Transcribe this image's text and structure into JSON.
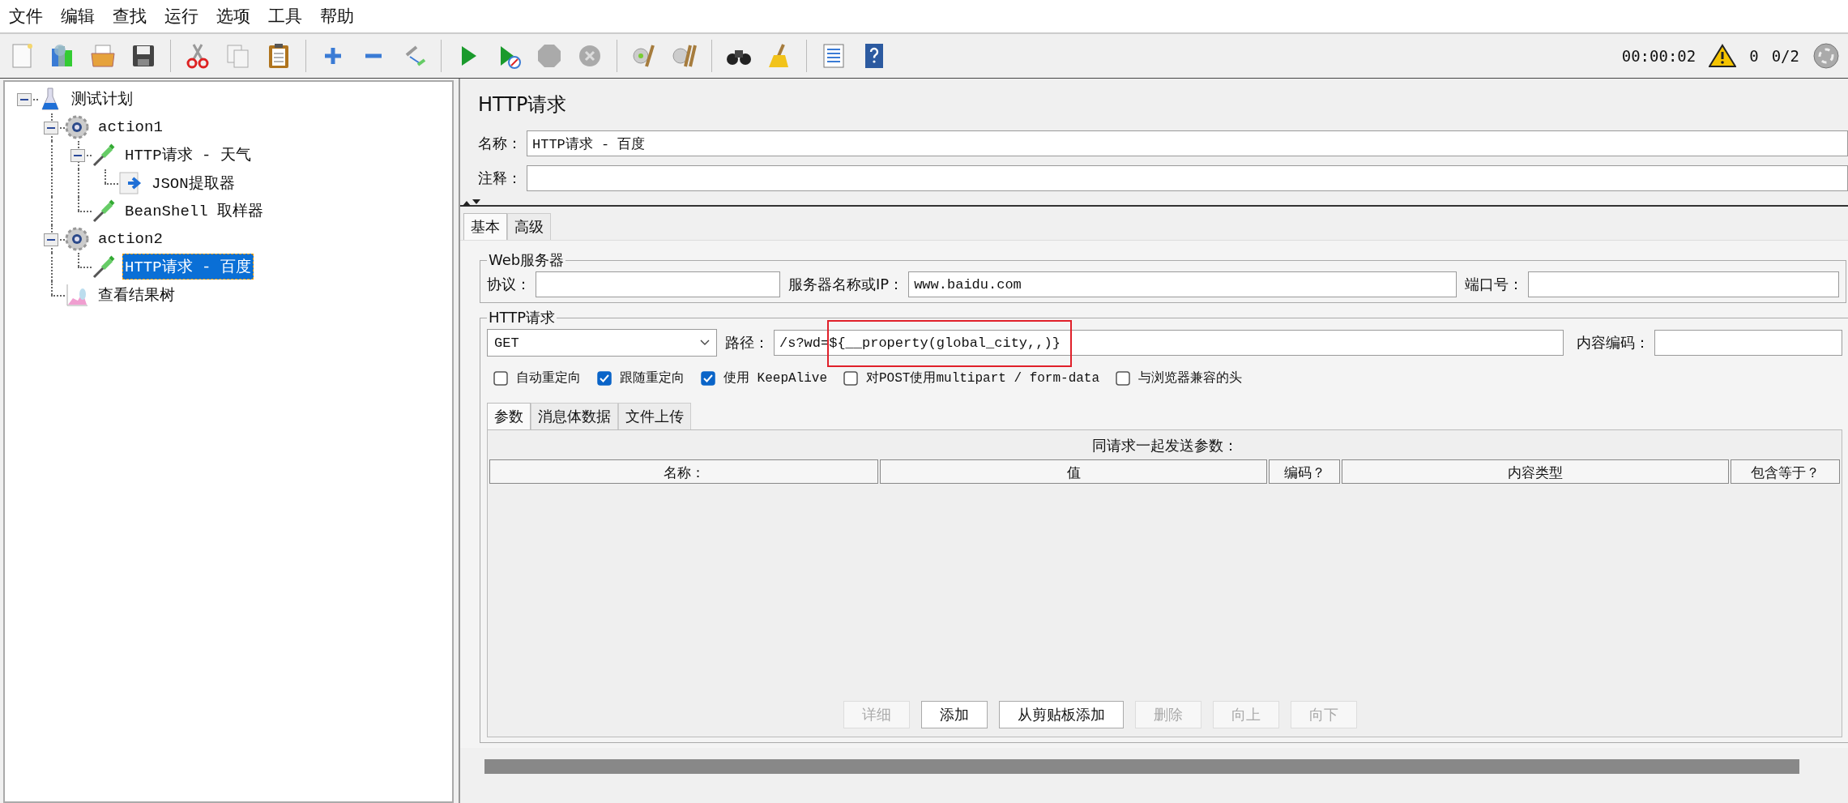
{
  "menu": [
    "文件",
    "编辑",
    "查找",
    "运行",
    "选项",
    "工具",
    "帮助"
  ],
  "status": {
    "elapsed": "00:00:02",
    "warnings": "0",
    "threads": "0/2"
  },
  "tree": [
    {
      "label": "测试计划",
      "kind": "plan",
      "expanded": true,
      "selected": false,
      "children": [
        {
          "label": "action1",
          "kind": "thread-group",
          "expanded": true,
          "selected": false,
          "children": [
            {
              "label": "HTTP请求 - 天气",
              "kind": "sampler",
              "expanded": true,
              "selected": false,
              "children": [
                {
                  "label": "JSON提取器",
                  "kind": "extractor",
                  "selected": false
                }
              ]
            },
            {
              "label": "BeanShell 取样器",
              "kind": "sampler",
              "selected": false
            }
          ]
        },
        {
          "label": "action2",
          "kind": "thread-group",
          "expanded": true,
          "selected": false,
          "children": [
            {
              "label": "HTTP请求 - 百度",
              "kind": "sampler",
              "selected": true
            }
          ]
        },
        {
          "label": "查看结果树",
          "kind": "listener",
          "selected": false
        }
      ]
    }
  ],
  "panel": {
    "title": "HTTP请求",
    "name": {
      "label": "名称：",
      "value": "HTTP请求 - 百度"
    },
    "comment": {
      "label": "注释："
    },
    "tabs": [
      {
        "label": "基本",
        "selected": true
      },
      {
        "label": "高级",
        "selected": false
      }
    ],
    "web_server": {
      "legend": "Web服务器",
      "protocol": {
        "label": "协议："
      },
      "server": {
        "label": "服务器名称或IP：",
        "value": "www.baidu.com"
      },
      "port": {
        "label": "端口号："
      }
    },
    "http_request": {
      "legend": "HTTP请求",
      "method": "GET",
      "path": {
        "label": "路径：",
        "value": "/s?wd=",
        "highlighted_value": "${__property(global_city,,)}"
      },
      "encoding": {
        "label": "内容编码："
      },
      "options": [
        {
          "label": "自动重定向",
          "checked": false
        },
        {
          "label": "跟随重定向",
          "checked": true
        },
        {
          "label": "使用 KeepAlive",
          "checked": true
        },
        {
          "label": "对POST使用multipart / form-data",
          "checked": false
        },
        {
          "label": "与浏览器兼容的头",
          "checked": false
        }
      ],
      "tabs": [
        {
          "label": "参数",
          "selected": true
        },
        {
          "label": "消息体数据",
          "selected": false
        },
        {
          "label": "文件上传",
          "selected": false
        }
      ],
      "table_title": "同请求一起发送参数：",
      "columns": [
        "名称：",
        "值",
        "编码？",
        "内容类型",
        "包含等于？"
      ],
      "buttons": [
        {
          "label": "详细",
          "disabled": true
        },
        {
          "label": "添加",
          "disabled": false
        },
        {
          "label": "从剪贴板添加",
          "disabled": false
        },
        {
          "label": "删除",
          "disabled": true
        },
        {
          "label": "向上",
          "disabled": true
        },
        {
          "label": "向下",
          "disabled": true
        }
      ]
    }
  }
}
